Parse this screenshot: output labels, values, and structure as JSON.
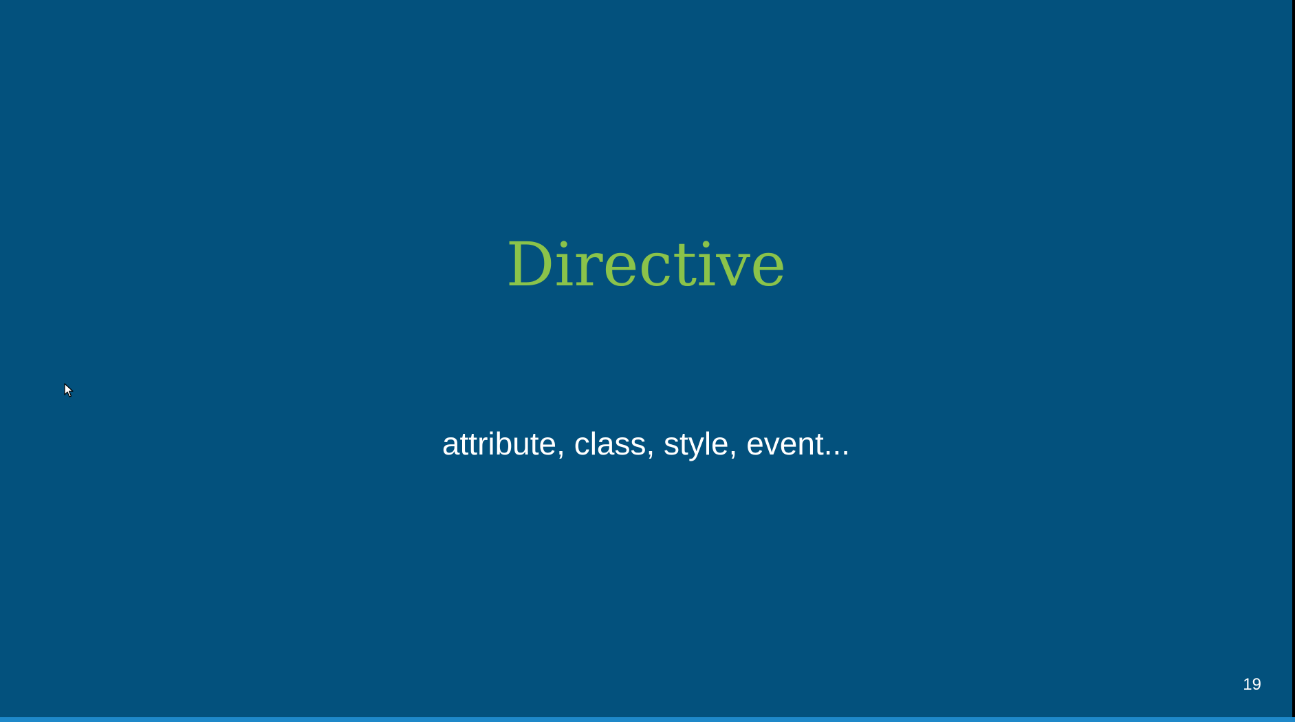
{
  "slide": {
    "title": "Directive",
    "subtitle": "attribute, class, style, event...",
    "page_number": "19"
  },
  "progress": {
    "fraction": 1.0
  },
  "colors": {
    "background": "#03517d",
    "title": "#8bc34a",
    "text": "#ffffff",
    "progress": "#1e88c9"
  },
  "icons": {
    "cursor": "mouse-pointer-icon"
  }
}
